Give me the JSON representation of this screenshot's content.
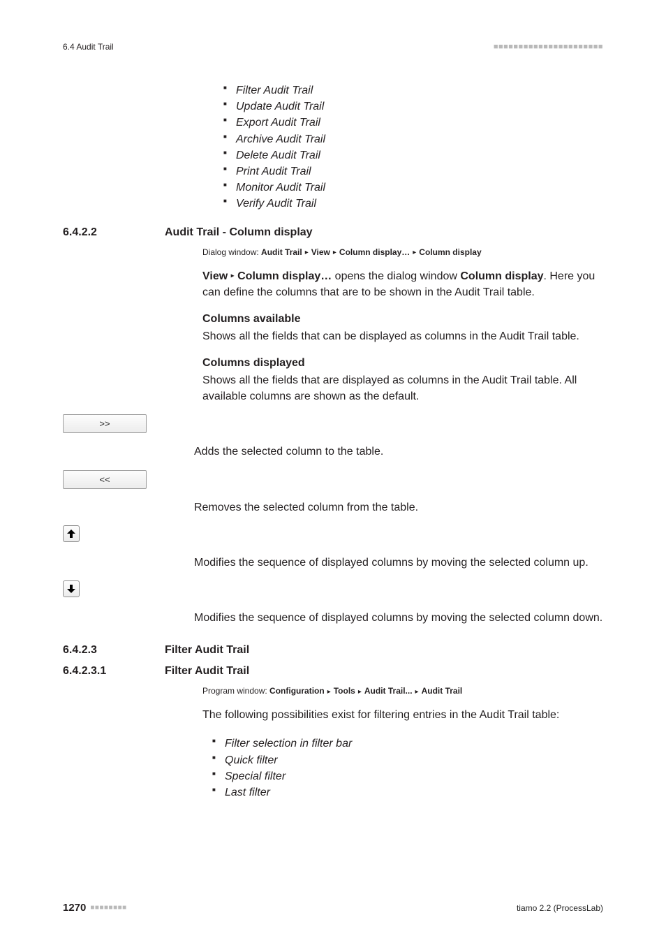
{
  "header": {
    "section_ref": "6.4 Audit Trail"
  },
  "top_list": [
    "Filter Audit Trail",
    "Update Audit Trail",
    "Export Audit Trail",
    "Archive Audit Trail",
    "Delete Audit Trail",
    "Print Audit Trail",
    "Monitor Audit Trail",
    "Verify Audit Trail"
  ],
  "sec6422": {
    "num": "6.4.2.2",
    "title": "Audit Trail - Column display",
    "crumb_prefix": "Dialog window: ",
    "crumb_parts": [
      "Audit Trail",
      "View",
      "Column display…",
      "Column display"
    ],
    "para1_pre": "View",
    "para1_sep_cmd": "Column display…",
    "para1_mid": " opens the dialog window ",
    "para1_bold2": "Column display",
    "para1_post": ". Here you can define the columns that are to be shown in the Audit Trail table.",
    "cols_avail_head": "Columns available",
    "cols_avail_text": "Shows all the fields that can be displayed as columns in the Audit Trail table.",
    "cols_disp_head": "Columns displayed",
    "cols_disp_text": "Shows all the fields that are displayed as columns in the Audit Trail table. All available columns are shown as the default.",
    "btn_add_label": ">>",
    "btn_add_desc": "Adds the selected column to the table.",
    "btn_remove_label": "<<",
    "btn_remove_desc": "Removes the selected column from the table.",
    "btn_up_desc": "Modifies the sequence of displayed columns by moving the selected column up.",
    "btn_down_desc": "Modifies the sequence of displayed columns by moving the selected column down."
  },
  "sec6423": {
    "num": "6.4.2.3",
    "title": "Filter Audit Trail"
  },
  "sec64231": {
    "num": "6.4.2.3.1",
    "title": "Filter Audit Trail",
    "crumb_prefix": "Program window: ",
    "crumb_parts": [
      "Configuration",
      "Tools",
      "Audit Trail...",
      "Audit Trail"
    ],
    "intro": "The following possibilities exist for filtering entries in the Audit Trail table:",
    "items": [
      "Filter selection in filter bar",
      "Quick filter",
      "Special filter",
      "Last filter"
    ]
  },
  "footer": {
    "page": "1270",
    "product": "tiamo 2.2 (ProcessLab)"
  }
}
